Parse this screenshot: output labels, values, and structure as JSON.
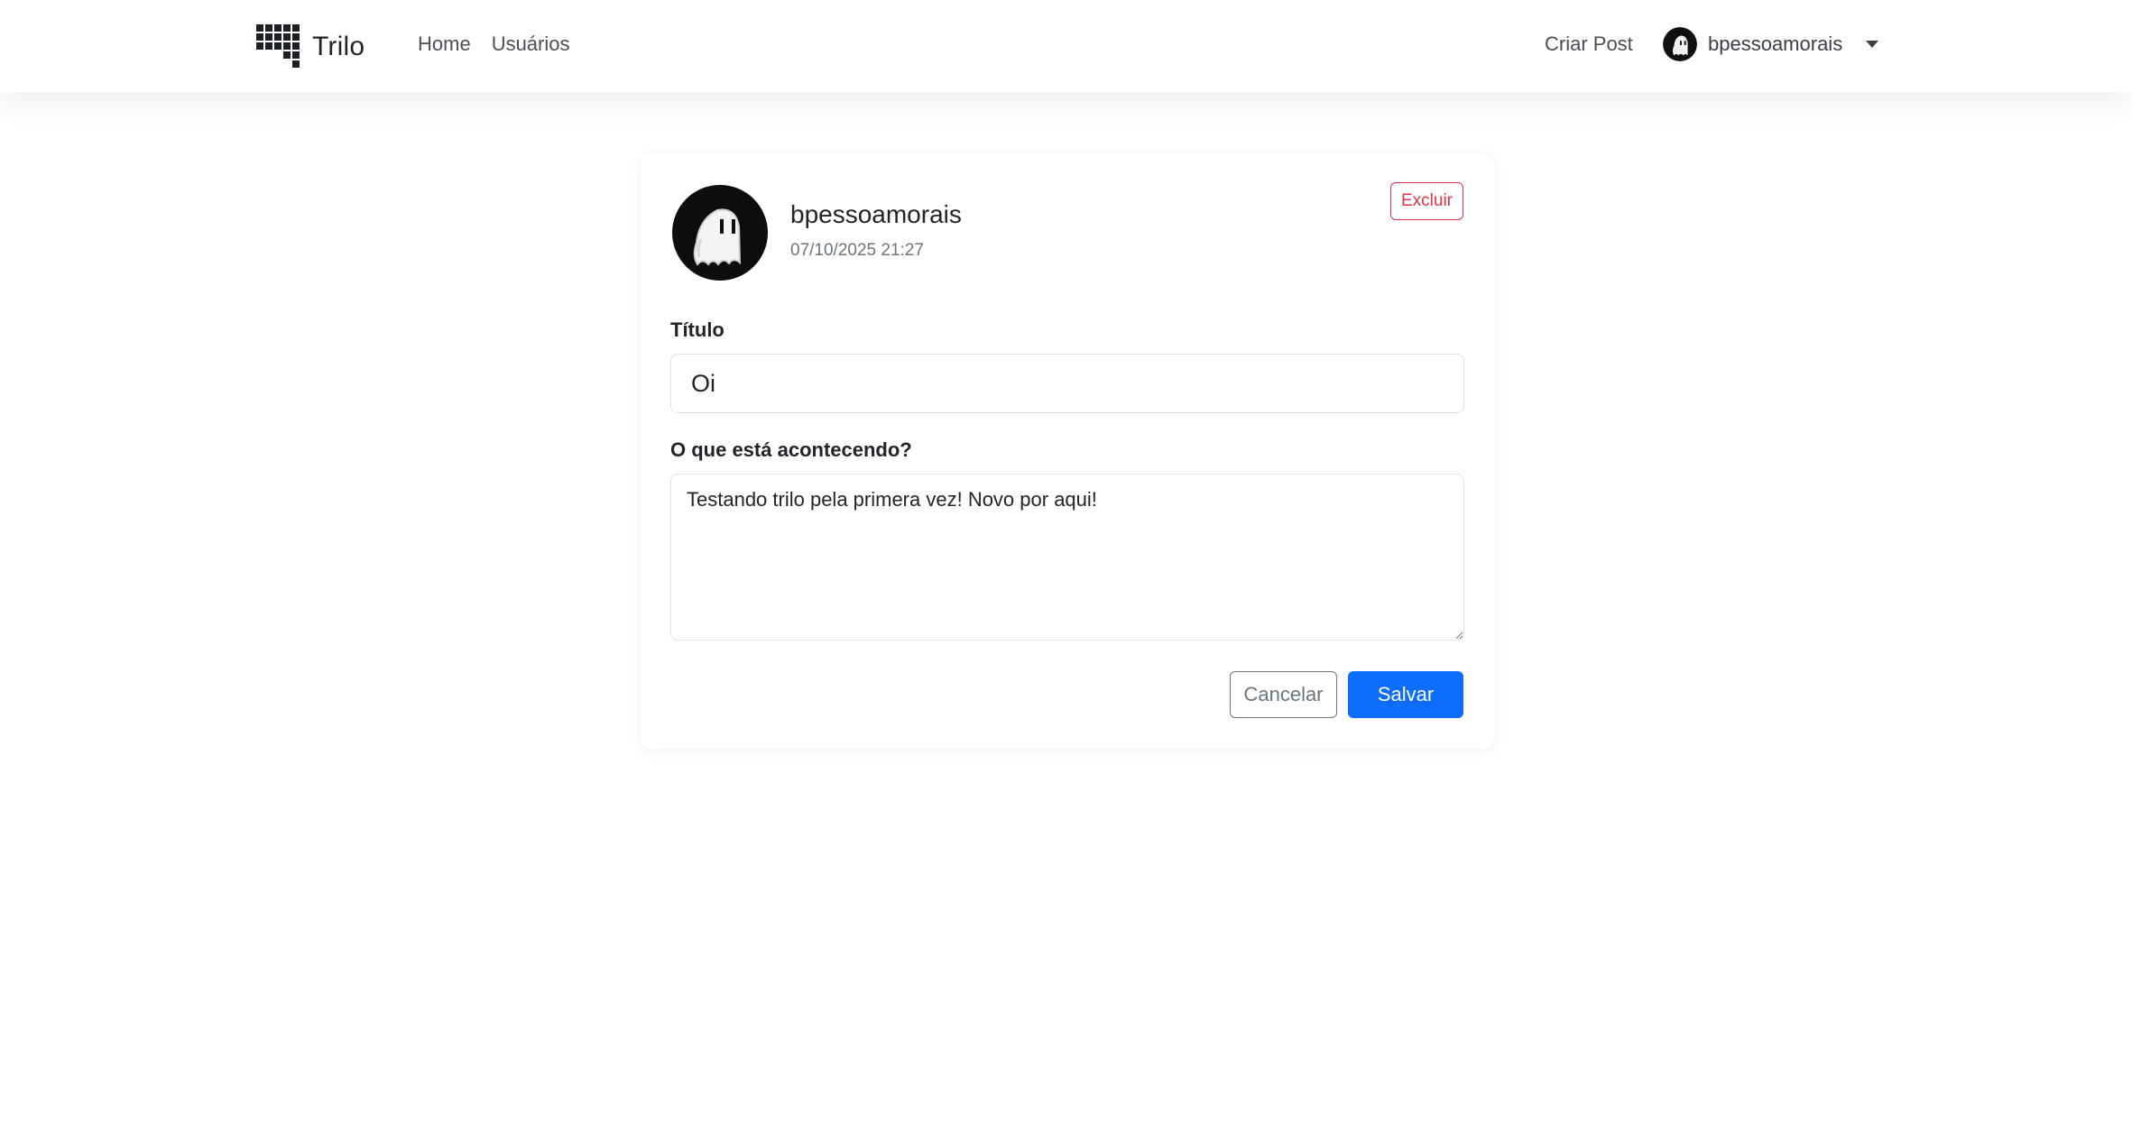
{
  "navbar": {
    "brand": {
      "icon": "grid-logo-icon",
      "name": "Trilo"
    },
    "links": [
      {
        "label": "Home"
      },
      {
        "label": "Usuários"
      }
    ],
    "create_post": "Criar Post",
    "user": {
      "username": "bpessoamorais",
      "avatar_icon": "ghost-avatar-icon"
    }
  },
  "post_editor": {
    "author": "bpessoamorais",
    "timestamp": "07/10/2025 21:27",
    "delete_label": "Excluir",
    "title_label": "Título",
    "title_value": "Oi",
    "body_label": "O que está acontecendo?",
    "body_value": "Testando trilo pela primera vez! Novo por aqui!",
    "cancel_label": "Cancelar",
    "save_label": "Salvar"
  },
  "colors": {
    "primary": "#0d6efd",
    "danger": "#dc3545",
    "secondary": "#6c757d"
  }
}
